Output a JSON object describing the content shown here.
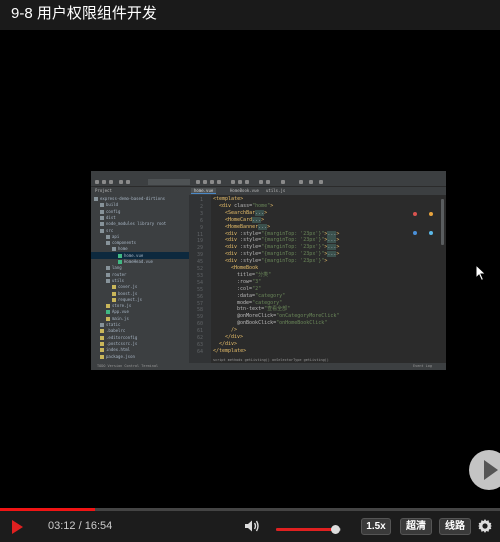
{
  "header": {
    "title": "9-8 用户权限组件开发"
  },
  "ide": {
    "toolbar_tab": "dxvue-fronted-sources",
    "project_label": "Project",
    "tree": [
      {
        "label": "express-demo-based-dirtions",
        "indent": 0,
        "icon": "folder"
      },
      {
        "label": "build",
        "indent": 1,
        "icon": "folder"
      },
      {
        "label": "config",
        "indent": 1,
        "icon": "folder"
      },
      {
        "label": "dist",
        "indent": 1,
        "icon": "folder"
      },
      {
        "label": "node_modules library root",
        "indent": 1,
        "icon": "folder"
      },
      {
        "label": "src",
        "indent": 1,
        "icon": "folder"
      },
      {
        "label": "api",
        "indent": 2,
        "icon": "folder"
      },
      {
        "label": "components",
        "indent": 2,
        "icon": "folder"
      },
      {
        "label": "home",
        "indent": 3,
        "icon": "folder"
      },
      {
        "label": "home.vue",
        "indent": 4,
        "icon": "vue",
        "selected": true
      },
      {
        "label": "HomeHead.vue",
        "indent": 4,
        "icon": "vue"
      },
      {
        "label": "lang",
        "indent": 2,
        "icon": "folder"
      },
      {
        "label": "router",
        "indent": 2,
        "icon": "folder"
      },
      {
        "label": "utils",
        "indent": 2,
        "icon": "folder"
      },
      {
        "label": "cover.js",
        "indent": 3,
        "icon": "js"
      },
      {
        "label": "boost.js",
        "indent": 3,
        "icon": "js"
      },
      {
        "label": "request.js",
        "indent": 3,
        "icon": "js"
      },
      {
        "label": "store.js",
        "indent": 2,
        "icon": "js"
      },
      {
        "label": "App.vue",
        "indent": 2,
        "icon": "vue"
      },
      {
        "label": "main.js",
        "indent": 2,
        "icon": "js"
      },
      {
        "label": "static",
        "indent": 1,
        "icon": "folder"
      },
      {
        "label": ".babelrc",
        "indent": 1,
        "icon": "js"
      },
      {
        "label": ".editorconfig",
        "indent": 1,
        "icon": "js"
      },
      {
        "label": ".postcssrc.js",
        "indent": 1,
        "icon": "js"
      },
      {
        "label": "index.html",
        "indent": 1,
        "icon": "js"
      },
      {
        "label": "package.json",
        "indent": 1,
        "icon": "js"
      }
    ],
    "editor_tabs": [
      "home.vue",
      "HomeBook.vue",
      "utils.js"
    ],
    "line_numbers": [
      "1",
      "2",
      "3",
      "6",
      "9",
      "11",
      "19",
      "29",
      "39",
      "45",
      "52",
      "53",
      "54",
      "55",
      "56",
      "57",
      "58",
      "59",
      "60",
      "61",
      "62",
      "63",
      "64",
      "65",
      "66"
    ],
    "code_lines": [
      {
        "indent": 0,
        "parts": [
          [
            "t",
            "<template>"
          ]
        ]
      },
      {
        "indent": 1,
        "parts": [
          [
            "t",
            "<div "
          ],
          [
            "a",
            "class="
          ],
          [
            "s",
            "\"home\""
          ],
          [
            "t",
            ">"
          ]
        ]
      },
      {
        "indent": 2,
        "parts": [
          [
            "t",
            "<SearchBar"
          ],
          [
            "f",
            "..."
          ],
          [
            "t",
            ">"
          ]
        ]
      },
      {
        "indent": 2,
        "parts": [
          [
            "t",
            "<HomeCard"
          ],
          [
            "f",
            "..."
          ],
          [
            "t",
            ">"
          ]
        ]
      },
      {
        "indent": 2,
        "parts": [
          [
            "t",
            "<HomeBanner"
          ],
          [
            "f",
            "..."
          ],
          [
            "t",
            ">"
          ]
        ]
      },
      {
        "indent": 2,
        "parts": [
          [
            "t",
            "<div "
          ],
          [
            "a",
            ":style="
          ],
          [
            "s",
            "\"{marginTop: '23px'}\""
          ],
          [
            "t",
            ">"
          ],
          [
            "f",
            "..."
          ],
          [
            "t",
            ">"
          ]
        ]
      },
      {
        "indent": 2,
        "parts": [
          [
            "t",
            "<div "
          ],
          [
            "a",
            ":style="
          ],
          [
            "s",
            "\"{marginTop: '23px'}\""
          ],
          [
            "t",
            ">"
          ],
          [
            "f",
            "..."
          ],
          [
            "t",
            ">"
          ]
        ]
      },
      {
        "indent": 2,
        "parts": [
          [
            "t",
            "<div "
          ],
          [
            "a",
            ":style="
          ],
          [
            "s",
            "\"{marginTop: '23px'}\""
          ],
          [
            "t",
            ">"
          ],
          [
            "f",
            "..."
          ],
          [
            "t",
            ">"
          ]
        ]
      },
      {
        "indent": 2,
        "parts": [
          [
            "t",
            "<div "
          ],
          [
            "a",
            ":style="
          ],
          [
            "s",
            "\"{marginTop: '23px'}\""
          ],
          [
            "t",
            ">"
          ],
          [
            "f",
            "..."
          ],
          [
            "t",
            ">"
          ]
        ]
      },
      {
        "indent": 2,
        "parts": [
          [
            "t",
            "<div "
          ],
          [
            "a",
            ":style="
          ],
          [
            "s",
            "\"{marginTop: '23px'}\""
          ],
          [
            "t",
            ">"
          ]
        ]
      },
      {
        "indent": 3,
        "parts": [
          [
            "t",
            "<HomeBook"
          ]
        ]
      },
      {
        "indent": 4,
        "parts": [
          [
            "a",
            "title="
          ],
          [
            "s",
            "\"分类\""
          ]
        ]
      },
      {
        "indent": 4,
        "parts": [
          [
            "a",
            ":row="
          ],
          [
            "s",
            "\"3\""
          ]
        ]
      },
      {
        "indent": 4,
        "parts": [
          [
            "a",
            ":col="
          ],
          [
            "s",
            "\"2\""
          ]
        ]
      },
      {
        "indent": 4,
        "parts": [
          [
            "a",
            ":data="
          ],
          [
            "s",
            "\"category\""
          ]
        ]
      },
      {
        "indent": 4,
        "parts": [
          [
            "a",
            "mode="
          ],
          [
            "s",
            "\"category\""
          ]
        ]
      },
      {
        "indent": 4,
        "parts": [
          [
            "a",
            "btn-text="
          ],
          [
            "s",
            "\"查看全部\""
          ]
        ]
      },
      {
        "indent": 4,
        "parts": [
          [
            "a",
            "@onMoreClick="
          ],
          [
            "s",
            "\"onCategoryMoreClick\""
          ]
        ]
      },
      {
        "indent": 4,
        "parts": [
          [
            "a",
            "@onBookClick="
          ],
          [
            "s",
            "\"onHomeBookClick\""
          ]
        ]
      },
      {
        "indent": 3,
        "parts": [
          [
            "t",
            "/>"
          ]
        ]
      },
      {
        "indent": 2,
        "parts": [
          [
            "t",
            "</div>"
          ]
        ]
      },
      {
        "indent": 1,
        "parts": [
          [
            "t",
            "</div>"
          ]
        ]
      },
      {
        "indent": 0,
        "parts": [
          [
            "t",
            "</template>"
          ]
        ]
      }
    ],
    "breadcrumbs": "script  methods  getListing()  onSelectorType  getListing()",
    "status_left": "TODO   Version Control   Terminal",
    "status_right": "Event Log"
  },
  "player": {
    "current_time": "03:12",
    "duration": "16:54",
    "time_separator": " / ",
    "progress": 0.189,
    "volume": 0.92,
    "speed_label": "1.5x",
    "quality_label": "超清",
    "route_label": "线路"
  },
  "colors": {
    "accent": "#e02020",
    "background": "#000000",
    "control_bar": "#1c1c1c"
  }
}
